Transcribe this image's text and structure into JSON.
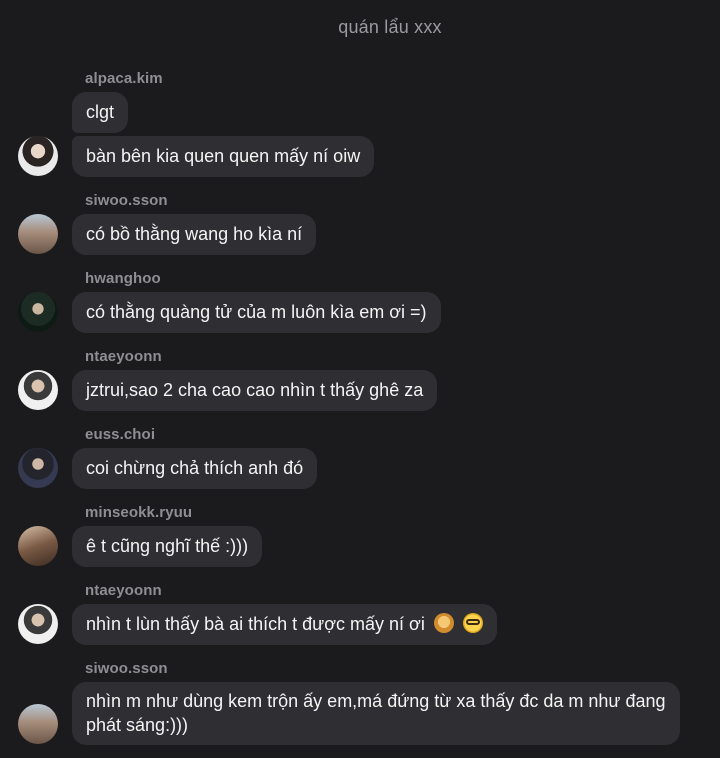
{
  "chat": {
    "title": "quán lẩu xxx"
  },
  "messages": [
    {
      "sender": "alpaca.kim",
      "texts": [
        "clgt",
        "bàn bên kia quen quen mấy ní oiw"
      ]
    },
    {
      "sender": "siwoo.sson",
      "texts": [
        "có bồ thằng wang ho kìa ní"
      ]
    },
    {
      "sender": "hwanghoo",
      "texts": [
        "có thằng quàng tử của m luôn kìa em ơi =)"
      ]
    },
    {
      "sender": "ntaeyoonn",
      "texts": [
        "jztrui,sao 2 cha cao cao nhìn t thấy ghê za"
      ]
    },
    {
      "sender": "euss.choi",
      "texts": [
        "coi chừng chả thích anh đó"
      ]
    },
    {
      "sender": "minseokk.ryuu",
      "texts": [
        "ê t cũng nghĩ thế :)))"
      ]
    },
    {
      "sender": "ntaeyoonn",
      "texts": [
        "nhìn t lùn thấy bà ai thích t được mấy ní ơi"
      ],
      "emojis": [
        "woman-gesturing-icon",
        "nerd-face-icon"
      ]
    },
    {
      "sender": "siwoo.sson",
      "texts": [
        "nhìn m như dùng kem trộn ấy em,má đứng từ xa thấy đc da m như đang phát sáng:)))"
      ]
    }
  ]
}
